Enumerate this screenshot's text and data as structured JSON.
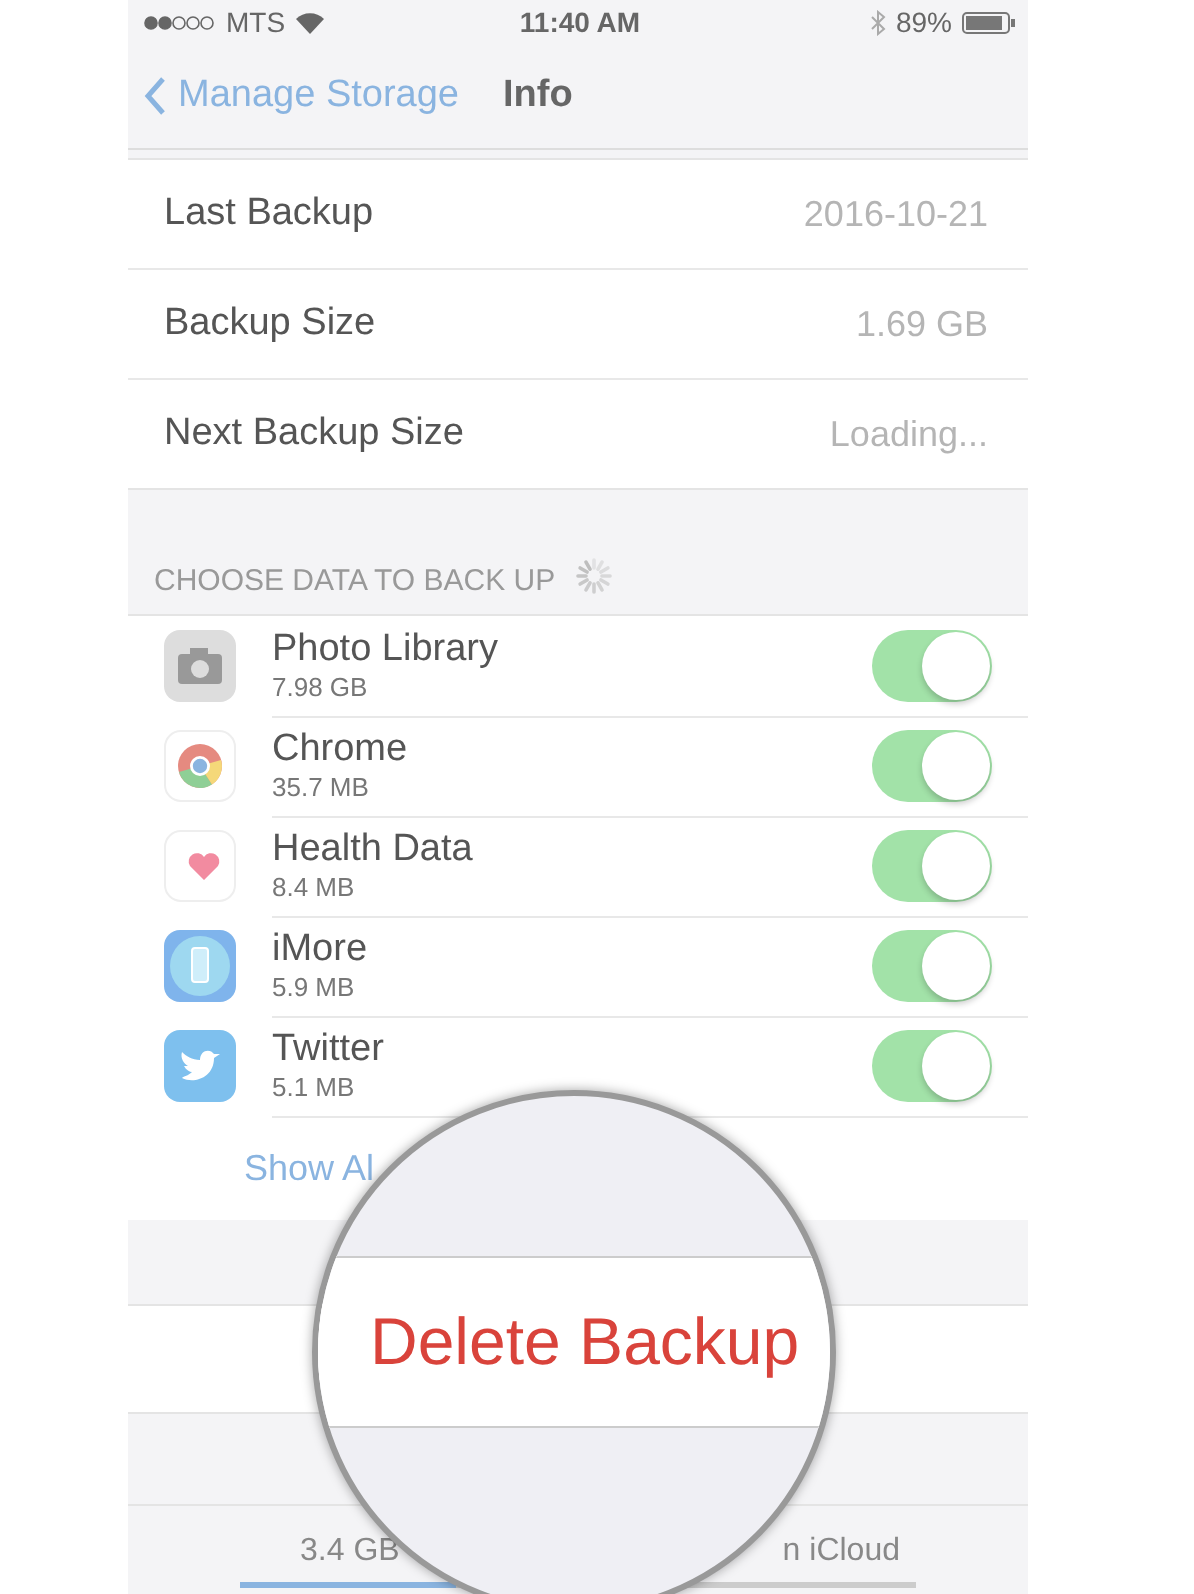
{
  "status_bar": {
    "carrier": "MTS",
    "time": "11:40 AM",
    "battery": "89%"
  },
  "nav": {
    "back": "Manage Storage",
    "title": "Info"
  },
  "info_rows": [
    {
      "label": "Last Backup",
      "value": "2016-10-21"
    },
    {
      "label": "Backup Size",
      "value": "1.69 GB"
    },
    {
      "label": "Next Backup Size",
      "value": "Loading..."
    }
  ],
  "section_header": "CHOOSE DATA TO BACK UP",
  "apps": [
    {
      "kind": "photos",
      "name": "Photo Library",
      "size": "7.98 GB",
      "on": true
    },
    {
      "kind": "chrome",
      "name": "Chrome",
      "size": "35.7 MB",
      "on": true
    },
    {
      "kind": "health",
      "name": "Health Data",
      "size": "8.4 MB",
      "on": true
    },
    {
      "kind": "imore",
      "name": "iMore",
      "size": "5.9 MB",
      "on": true
    },
    {
      "kind": "twitter",
      "name": "Twitter",
      "size": "5.1 MB",
      "on": true
    }
  ],
  "show_all": "Show Al",
  "delete_button": "Delete Backup",
  "footer": {
    "used": "3.4 GB",
    "available": "n iCloud",
    "level": 0.32
  }
}
